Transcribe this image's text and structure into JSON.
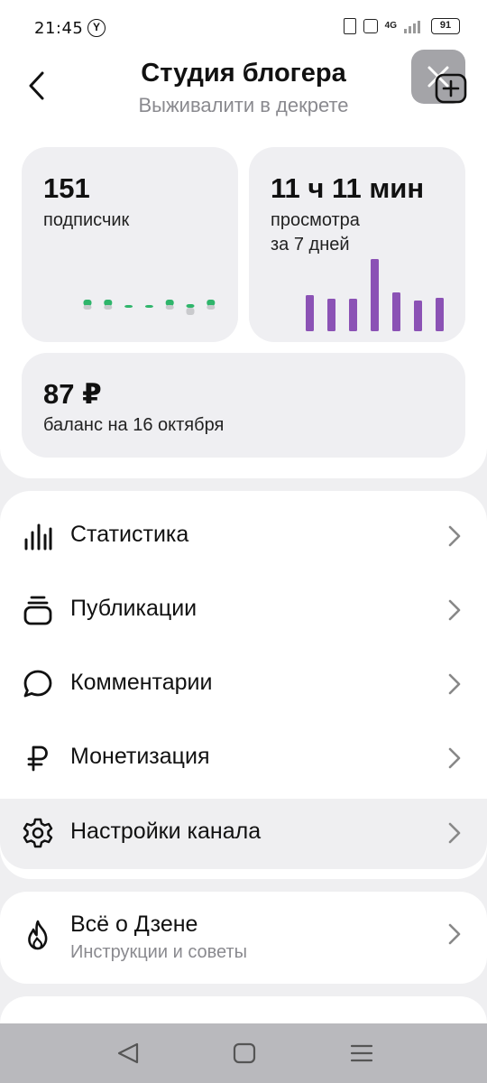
{
  "status_bar": {
    "time": "21:45",
    "network": "4G",
    "battery": "91"
  },
  "header": {
    "title": "Студия блогера",
    "subtitle": "Выживалити в декрете"
  },
  "stats": {
    "subscribers": {
      "value": "151",
      "label": "подписчик"
    },
    "views": {
      "value": "11 ч 11 мин",
      "label_line1": "просмотра",
      "label_line2": "за 7 дней"
    },
    "balance": {
      "value": "87 ₽",
      "label": "баланс на 16 октября"
    },
    "subscribers_trend": [
      1,
      1,
      0,
      0,
      1,
      -1,
      1
    ],
    "views_bars": [
      40,
      36,
      36,
      80,
      43,
      34,
      37
    ]
  },
  "menu": {
    "items": [
      {
        "label": "Статистика",
        "icon": "bar-chart-icon"
      },
      {
        "label": "Публикации",
        "icon": "publications-icon"
      },
      {
        "label": "Комментарии",
        "icon": "comment-icon"
      },
      {
        "label": "Монетизация",
        "icon": "ruble-icon"
      },
      {
        "label": "Настройки канала",
        "icon": "gear-icon"
      }
    ]
  },
  "about": {
    "title": "Всё о Дзене",
    "subtitle": "Инструкции и советы",
    "icon": "flame-icon"
  },
  "colors": {
    "accent_green": "#2fb56b",
    "accent_purple": "#8b52b5",
    "card_bg": "#efeff2",
    "text_secondary": "#8a8a8f"
  }
}
